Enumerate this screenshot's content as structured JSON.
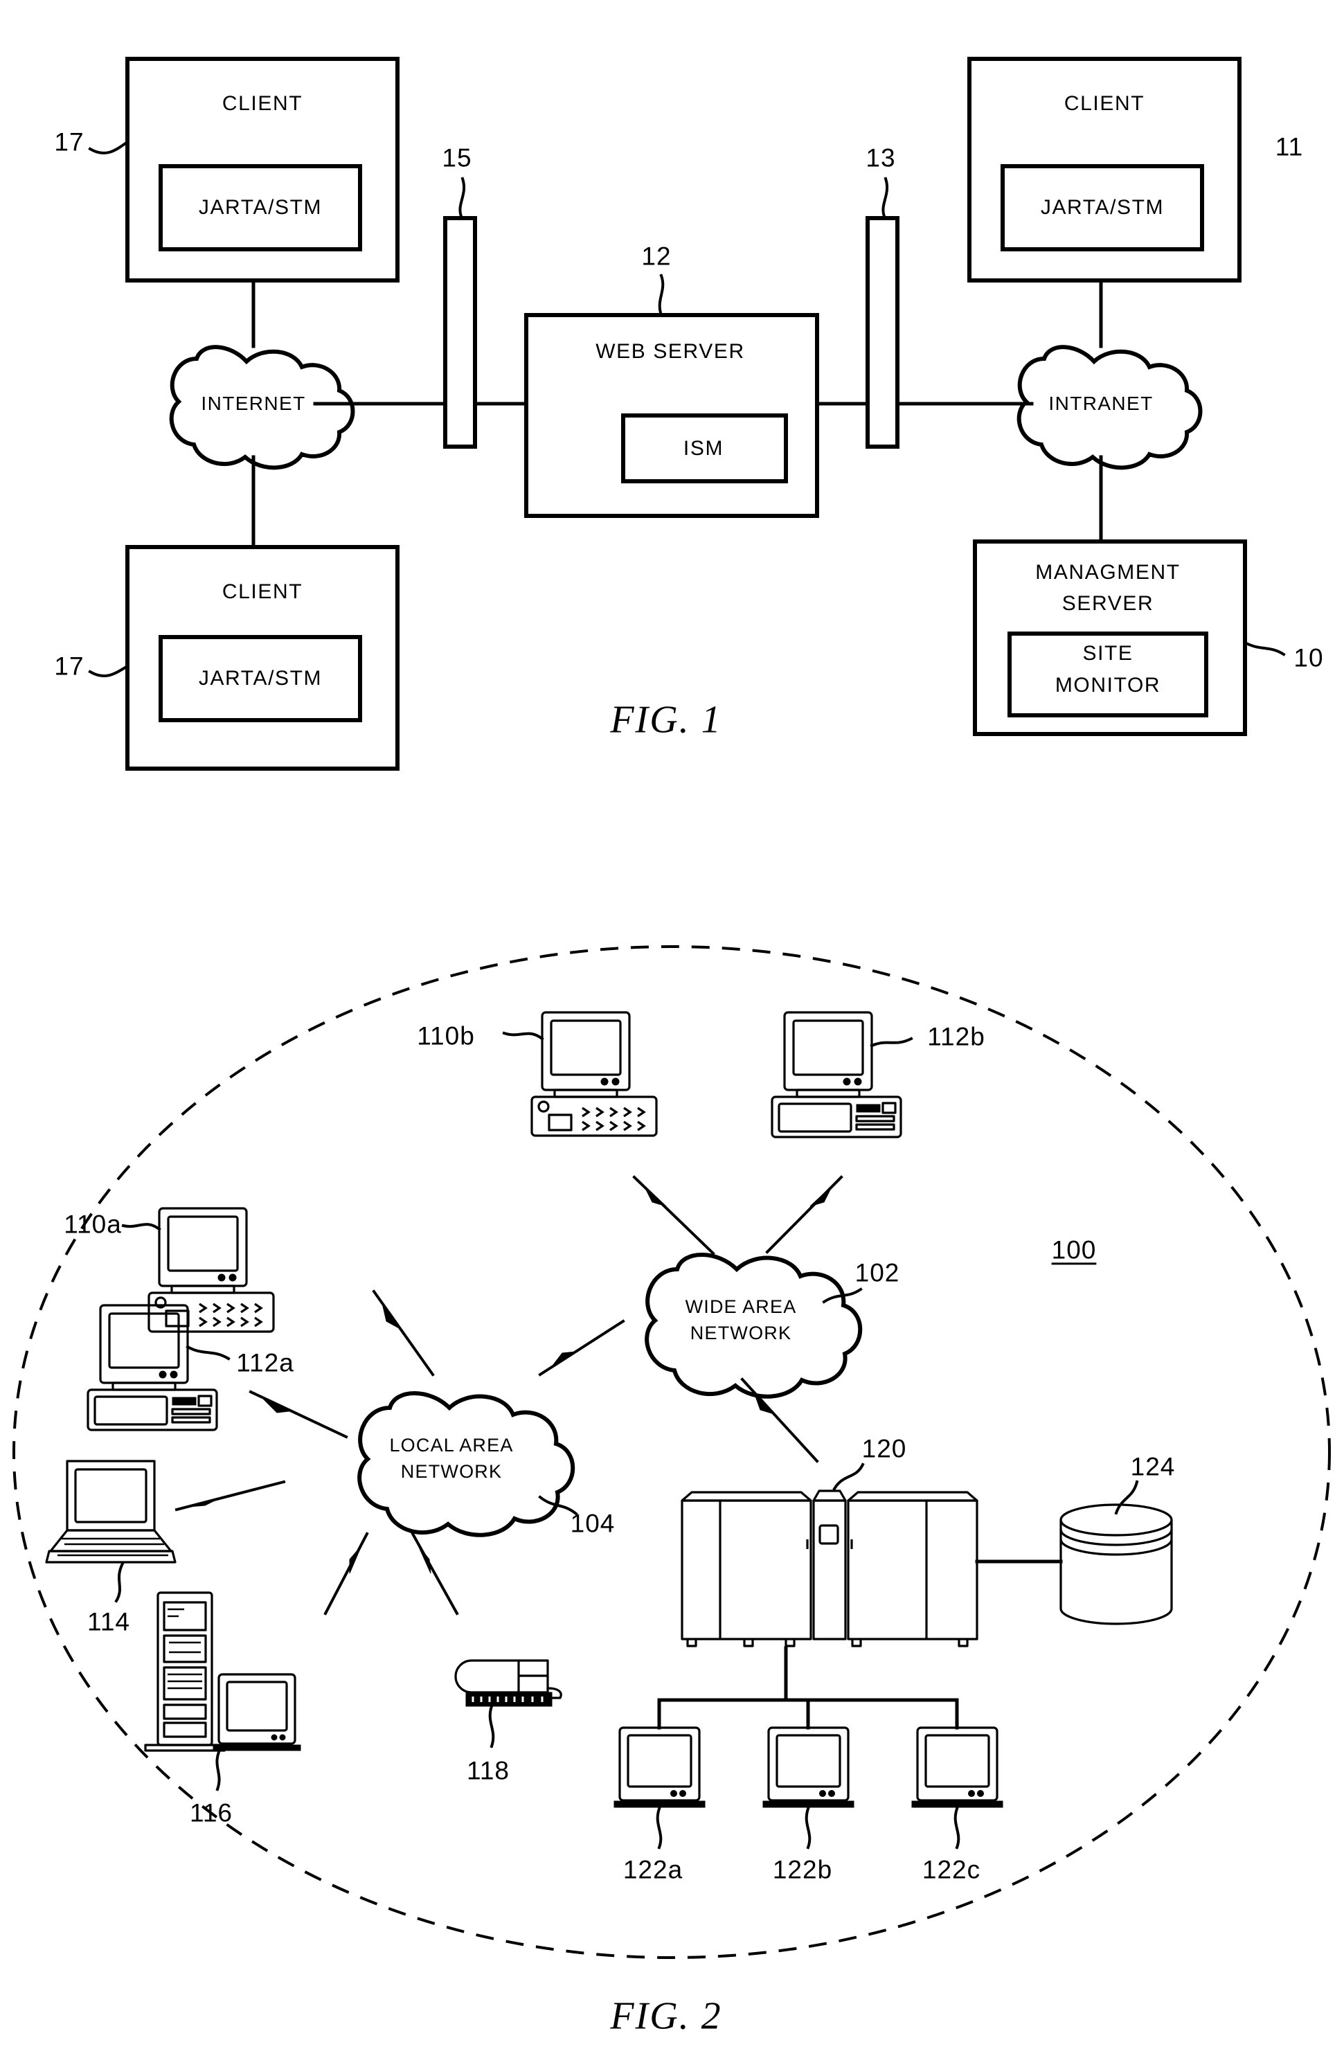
{
  "document": {
    "type": "patent-drawing-sheet",
    "figures": [
      "FIG. 1",
      "FIG. 2"
    ]
  },
  "figure1": {
    "caption": "FIG.  1",
    "boxes": {
      "client_top": {
        "title": "CLIENT",
        "inner": "JARTA/STM",
        "ref": "17"
      },
      "client_bottom": {
        "title": "CLIENT",
        "inner": "JARTA/STM",
        "ref": "17"
      },
      "client_right": {
        "title": "CLIENT",
        "inner": "JARTA/STM",
        "ref": "11"
      },
      "web_server": {
        "title": "WEB SERVER",
        "inner": "ISM",
        "ref": "12"
      },
      "management_server": {
        "title_line1": "MANAGMENT",
        "title_line2": "SERVER",
        "inner_line1": "SITE",
        "inner_line2": "MONITOR",
        "ref": "10"
      }
    },
    "clouds": {
      "internet": "INTERNET",
      "intranet": "INTRANET"
    },
    "firewalls": {
      "left": {
        "ref": "15"
      },
      "right": {
        "ref": "13"
      }
    }
  },
  "figure2": {
    "caption": "FIG.  2",
    "system_ref": "100",
    "clouds": {
      "wan": {
        "line1": "WIDE  AREA",
        "line2": "NETWORK",
        "ref": "102"
      },
      "lan": {
        "line1": "LOCAL  AREA",
        "line2": "NETWORK",
        "ref": "104"
      }
    },
    "nodes": [
      {
        "ref": "110a",
        "kind": "desktop-computer-keyboard"
      },
      {
        "ref": "110b",
        "kind": "desktop-computer-keyboard"
      },
      {
        "ref": "112a",
        "kind": "desktop-computer-tower"
      },
      {
        "ref": "112b",
        "kind": "desktop-computer-tower"
      },
      {
        "ref": "114",
        "kind": "laptop-computer"
      },
      {
        "ref": "116",
        "kind": "server-tower"
      },
      {
        "ref": "118",
        "kind": "network-device"
      },
      {
        "ref": "120",
        "kind": "mainframe"
      },
      {
        "ref": "124",
        "kind": "storage-unit"
      },
      {
        "ref": "122a",
        "kind": "terminal"
      },
      {
        "ref": "122b",
        "kind": "terminal"
      },
      {
        "ref": "122c",
        "kind": "terminal"
      }
    ]
  },
  "colors": {
    "ink": "#000000",
    "paper": "#ffffff"
  }
}
